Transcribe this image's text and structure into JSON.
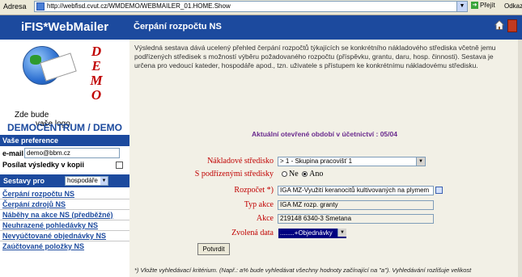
{
  "browser": {
    "address_label": "Adresa",
    "url": "http://webfisd.cvut.cz/WMDEMO/WEBMAILER_01.HOME.Show",
    "go_label": "Přejít",
    "links_label": "Odkazy"
  },
  "sidebar": {
    "brand": "iFIS*WebMailer",
    "logo_letters": [
      "D",
      "E",
      "M",
      "O"
    ],
    "logo_text_line1": "Zde bude",
    "logo_text_line2": "vaše logo",
    "org_name": "DEMOCENTRUM / DEMO",
    "preferences_heading": "Vaše preference",
    "email_label": "e-mail",
    "email_value": "demo@bbm.cz",
    "send_copy_label": "Posílat výsledky v kopii",
    "reports_label": "Sestavy pro",
    "reports_role": "hospodáře",
    "links": [
      "Čerpání rozpočtu NS",
      "Čerpání zdrojů NS",
      "Náběhy na akce NS (předběžné)",
      "Neuhrazené pohledávky NS",
      "Nevyúčtované objednávky NS",
      "Zaúčtované položky NS"
    ]
  },
  "main": {
    "title": "Čerpání rozpočtu NS",
    "description": "Výsledná sestava dává ucelený přehled čerpání rozpočtů týkajících se konkrétního nákladového střediska včetně jemu podřízených středisek s možností výběru požadovaného rozpočtu (příspěvku, grantu, daru, hosp. činnosti). Sestava je určena pro vedoucí kateder, hospodáře apod., tzn. uživatele s přístupem ke konkrétnímu nákladovému středisku.",
    "period_text": "Aktuální otevřené období v účetnictví : 05/04",
    "form": {
      "cost_center_label": "Nákladové středisko",
      "cost_center_value": "> 1 - Skupina pracovišť 1",
      "subcenters_label": "S podřízenými středisky",
      "radio_no": "Ne",
      "radio_yes": "Ano",
      "budget_label": "Rozpočet *)",
      "budget_value": "IGA MZ-Využití keranocitů kultivovaných na plymem",
      "action_type_label": "Typ akce",
      "action_type_value": "IGA MZ rozp. granty",
      "action_label": "Akce",
      "action_value": "219148 6340-3 Smetana",
      "data_label": "Zvolená data",
      "data_value": "........+Objednávky",
      "submit_label": "Potvrdit"
    },
    "footnote": "*) Vložte vyhledávací kritérium. (Např.: a% bude vyhledávat všechny hodnoty začínající na \"a\"). Vyhledávání rozlišuje velikost"
  }
}
